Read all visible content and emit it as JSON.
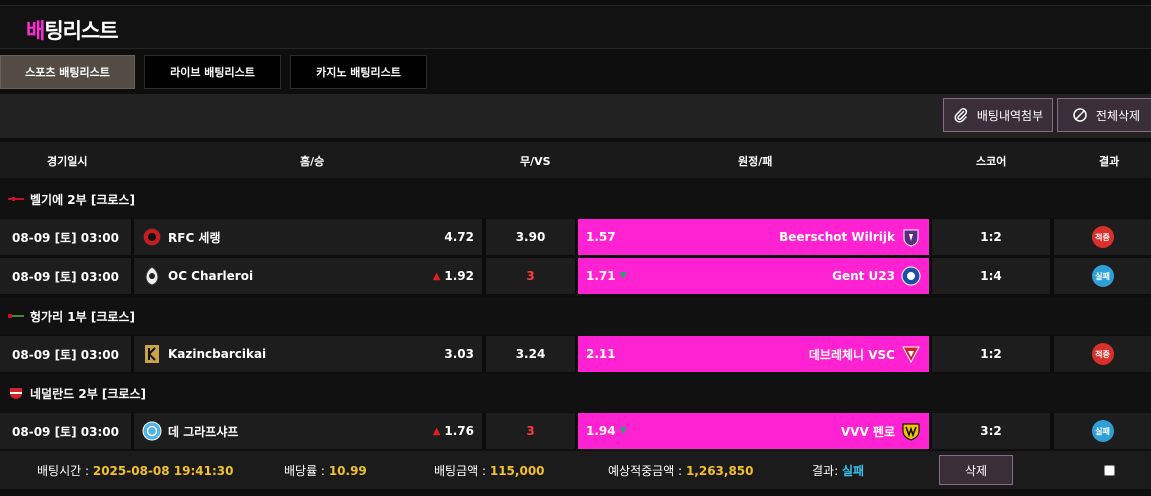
{
  "page": {
    "title_accent": "배",
    "title_rest": "팅리스트"
  },
  "tabs": [
    {
      "label": "스포츠 배팅리스트",
      "active": true
    },
    {
      "label": "라이브 배팅리스트",
      "active": false
    },
    {
      "label": "카지노 배팅리스트",
      "active": false
    }
  ],
  "toolbar": {
    "attach_label": "배팅내역첨부",
    "delete_all_label": "전체삭제"
  },
  "columns": {
    "date": "경기일시",
    "home": "홈/승",
    "draw": "무/VS",
    "away": "원정/패",
    "score": "스코어",
    "result": "결과"
  },
  "leagues": [
    {
      "name": "벨기에 2부 [크로스]"
    },
    {
      "name": "헝가리 1부 [크로스]"
    },
    {
      "name": "네덜란드 2부 [크로스]"
    }
  ],
  "rows": [
    {
      "time": "08-09 [토] 03:00",
      "home": "RFC 세랭",
      "home_odds": "4.72",
      "draw": "3.90",
      "away_odds": "1.57",
      "away": "Beerschot Wilrijk",
      "score": "1:2",
      "result": "적중"
    },
    {
      "time": "08-09 [토] 03:00",
      "home": "OC Charleroi",
      "home_odds": "1.92",
      "draw": "3",
      "away_odds": "1.71",
      "away": "Gent U23",
      "score": "1:4",
      "result": "실패"
    },
    {
      "time": "08-09 [토] 03:00",
      "home": "Kazincbarcikai",
      "home_odds": "3.03",
      "draw": "3.24",
      "away_odds": "2.11",
      "away": "데브레체니 VSC",
      "score": "1:2",
      "result": "적중"
    },
    {
      "time": "08-09 [토] 03:00",
      "home": "데 그라프샤프",
      "home_odds": "1.76",
      "draw": "3",
      "away_odds": "1.94",
      "away": "VVV 펜로",
      "score": "3:2",
      "result": "실패"
    }
  ],
  "summary": {
    "bet_time_label": "배팅시간 :",
    "bet_time": "2025-08-08 19:41:30",
    "odds_label": "배당률 :",
    "odds": "10.99",
    "amount_label": "배팅금액 :",
    "amount": "115,000",
    "expected_label": "예상적중금액 :",
    "expected": "1,263,850",
    "result_label": "결과:",
    "result": "실패",
    "delete_label": "삭제"
  },
  "colors": {
    "accent": "#ff22d2",
    "win": "#d9302c",
    "lose": "#2f9fd8",
    "gold": "#f2c12e"
  }
}
